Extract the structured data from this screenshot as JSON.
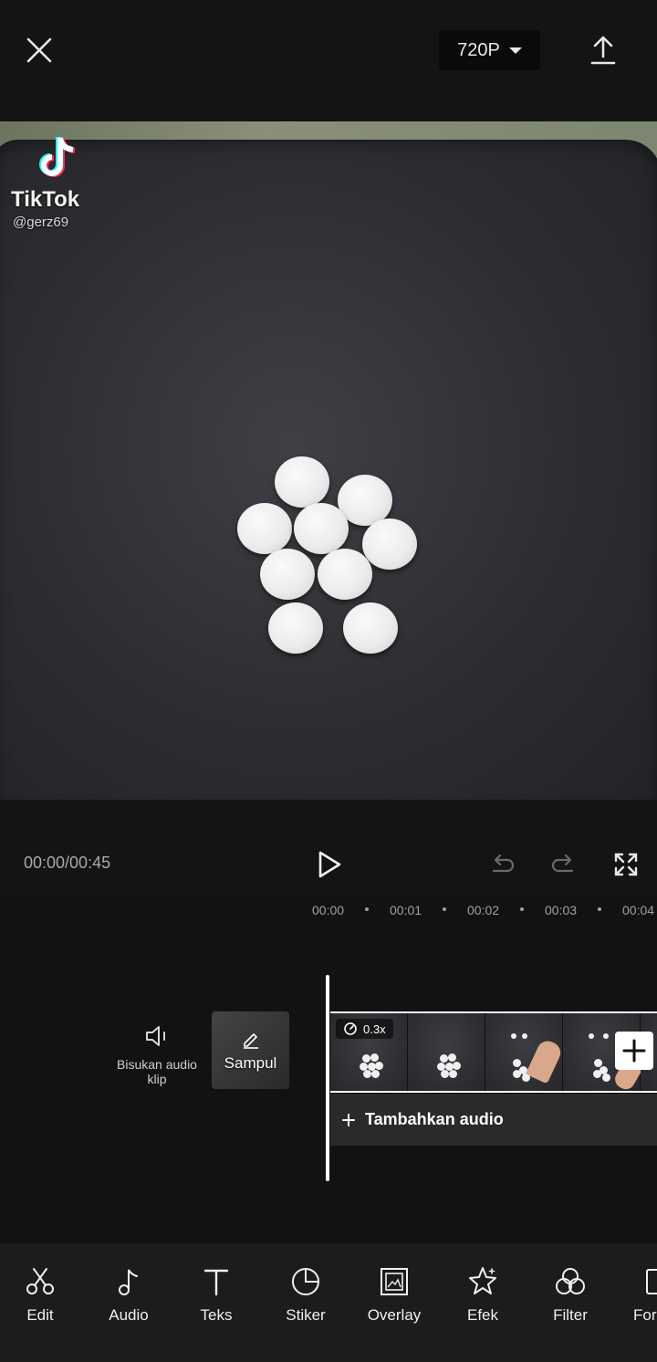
{
  "header": {
    "resolution": "720P",
    "close_icon": "close-icon",
    "export_icon": "upload-icon"
  },
  "preview": {
    "watermark_brand": "TikTok",
    "watermark_user": "@gerz69"
  },
  "player": {
    "time_display": "00:00/00:45"
  },
  "timeline": {
    "ruler": [
      "00:00",
      "00:01",
      "00:02",
      "00:03",
      "00:04"
    ],
    "mute_label": "Bisukan audio klip",
    "cover_label": "Sampul",
    "speed": "0.3x",
    "add_audio": "Tambahkan audio"
  },
  "toolbar": {
    "items": [
      {
        "label": "Edit",
        "icon": "scissors-icon"
      },
      {
        "label": "Audio",
        "icon": "music-note-icon"
      },
      {
        "label": "Teks",
        "icon": "text-icon"
      },
      {
        "label": "Stiker",
        "icon": "sticker-icon"
      },
      {
        "label": "Overlay",
        "icon": "overlay-icon"
      },
      {
        "label": "Efek",
        "icon": "effect-star-icon"
      },
      {
        "label": "Filter",
        "icon": "filter-icon"
      },
      {
        "label": "For",
        "icon": "format-icon"
      }
    ]
  },
  "colors": {
    "background": "#121212",
    "toolbar": "#1c1c1c",
    "accent": "#ffffff"
  }
}
